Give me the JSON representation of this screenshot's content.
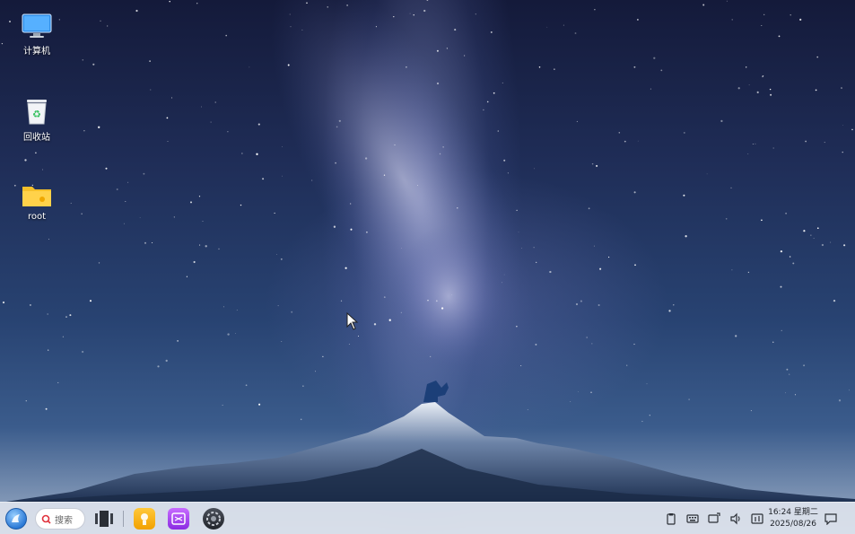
{
  "desktop": {
    "icons": [
      {
        "label": "计算机",
        "icon": "computer-icon"
      },
      {
        "label": "回收站",
        "icon": "trash-icon"
      },
      {
        "label": "root",
        "icon": "folder-icon"
      }
    ]
  },
  "taskbar": {
    "launcher_icon": "launcher-icon",
    "search": {
      "placeholder": "搜索"
    },
    "pinned_apps": [
      {
        "icon": "multitask-view-icon"
      },
      {
        "icon": "yellow-app-icon"
      },
      {
        "icon": "purple-app-icon"
      },
      {
        "icon": "settings-app-icon"
      }
    ],
    "tray": [
      "clipboard-icon",
      "keyboard-icon",
      "screen-cast-icon",
      "volume-icon",
      "monitor-icon"
    ],
    "clock": {
      "time": "16:24 星期二",
      "date": "2025/08/26"
    },
    "notification_icon": "notification-icon"
  },
  "colors": {
    "folder": "#f5c02a",
    "monitor": "#2f8fe8",
    "taskbar": "#dce2ec"
  }
}
